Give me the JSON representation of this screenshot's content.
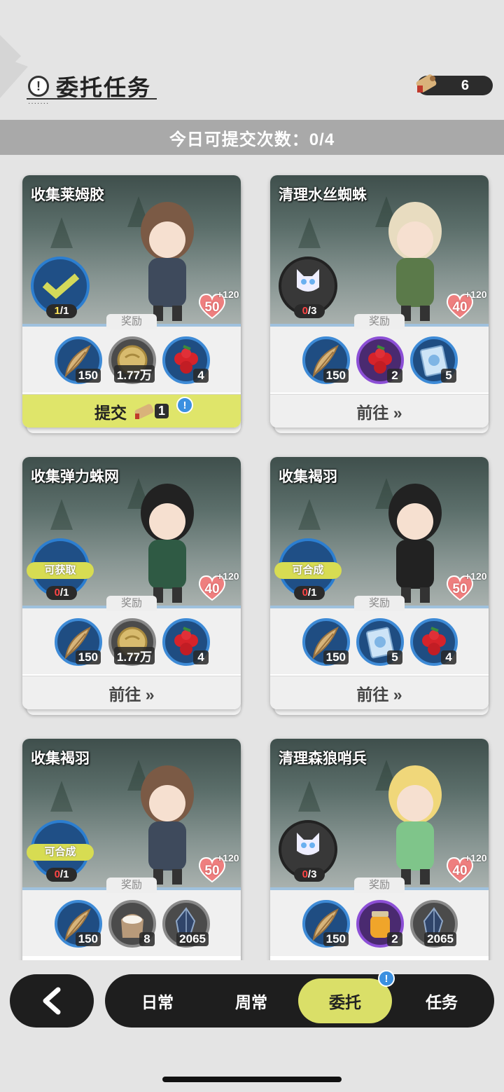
{
  "header": {
    "title": "委托任务",
    "currency_count": "6",
    "submit_info": "今日可提交次数：0/4"
  },
  "reward_label": "奖励",
  "cards": [
    {
      "title": "收集莱姆胶",
      "progress_done": "1",
      "progress_total": "1/1",
      "progress_text": "1/1",
      "status_tag": "",
      "affection": "50",
      "affection_bonus": "+120",
      "rewards": [
        {
          "icon": "feather-icon",
          "qty": "150"
        },
        {
          "icon": "gold-coin-icon",
          "qty": "1.77万"
        },
        {
          "icon": "red-berry-icon",
          "qty": "4"
        }
      ],
      "action": "提交",
      "action_count": "1"
    },
    {
      "title": "清理水丝蜘蛛",
      "progress_text": "0/3",
      "status_tag": "",
      "affection": "40",
      "affection_bonus": "+120",
      "rewards": [
        {
          "icon": "feather-icon",
          "qty": "150"
        },
        {
          "icon": "red-berry-icon",
          "qty": "2"
        },
        {
          "icon": "card-icon",
          "qty": "5"
        }
      ],
      "action": "前往 »"
    },
    {
      "title": "收集弹力蛛网",
      "progress_text": "0/1",
      "status_tag": "可获取",
      "affection": "40",
      "affection_bonus": "+120",
      "rewards": [
        {
          "icon": "feather-icon",
          "qty": "150"
        },
        {
          "icon": "gold-coin-icon",
          "qty": "1.77万"
        },
        {
          "icon": "red-berry-icon",
          "qty": "4"
        }
      ],
      "action": "前往 »"
    },
    {
      "title": "收集褐羽",
      "progress_text": "0/1",
      "status_tag": "可合成",
      "affection": "50",
      "affection_bonus": "+120",
      "rewards": [
        {
          "icon": "feather-icon",
          "qty": "150"
        },
        {
          "icon": "card-icon",
          "qty": "5"
        },
        {
          "icon": "red-berry-icon",
          "qty": "4"
        }
      ],
      "action": "前往 »"
    },
    {
      "title": "收集褐羽",
      "progress_text": "0/1",
      "status_tag": "可合成",
      "affection": "50",
      "affection_bonus": "+120",
      "rewards": [
        {
          "icon": "feather-icon",
          "qty": "150"
        },
        {
          "icon": "flour-sack-icon",
          "qty": "8"
        },
        {
          "icon": "crystal-icon",
          "qty": "2065"
        }
      ],
      "action": ""
    },
    {
      "title": "清理森狼哨兵",
      "progress_text": "0/3",
      "status_tag": "",
      "affection": "40",
      "affection_bonus": "+120",
      "rewards": [
        {
          "icon": "feather-icon",
          "qty": "150"
        },
        {
          "icon": "honey-jar-icon",
          "qty": "2"
        },
        {
          "icon": "crystal-icon",
          "qty": "2065"
        }
      ],
      "action": ""
    }
  ],
  "nav": {
    "tabs": [
      "日常",
      "周常",
      "委托",
      "任务"
    ],
    "active": "委托"
  },
  "colors": {
    "accent": "#dadf68",
    "reward_ring_blue": "#3d8ad6",
    "reward_ring_purple": "#8c4fd6"
  }
}
